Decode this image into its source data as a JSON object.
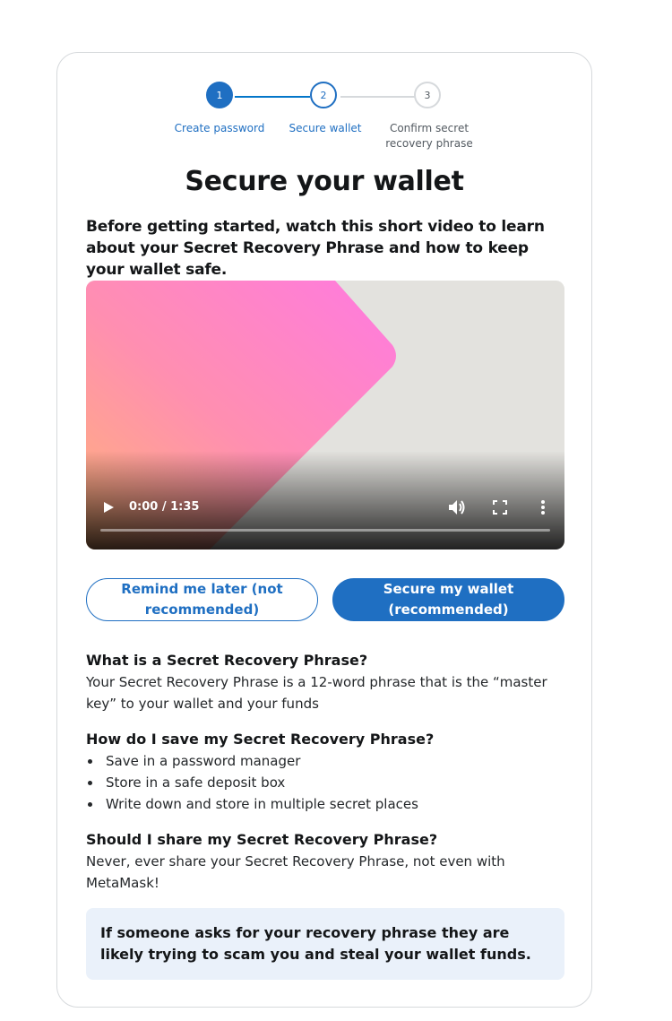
{
  "stepper": {
    "steps": [
      {
        "number": "1",
        "label": "Create password"
      },
      {
        "number": "2",
        "label": "Secure wallet"
      },
      {
        "number": "3",
        "label": "Confirm secret recovery phrase"
      }
    ],
    "current_step": 2
  },
  "title": "Secure your wallet",
  "intro": "Before getting started, watch this short video to learn about your Secret Recovery Phrase and how to keep your wallet safe.",
  "video": {
    "time": "0:00 / 1:35",
    "progress": 0,
    "controls": [
      "play-icon",
      "volume-icon",
      "fullscreen-icon",
      "more-options-icon"
    ]
  },
  "buttons": {
    "remind_later": "Remind me later (not recommended)",
    "secure_wallet": "Secure my wallet (recommended)"
  },
  "info": {
    "q1": "What is a Secret Recovery Phrase?",
    "a1": "Your Secret Recovery Phrase is a 12-word phrase that is the “master key” to your wallet and your funds",
    "q2": "How do I save my Secret Recovery Phrase?",
    "tips": [
      "Save in a password manager",
      "Store in a safe deposit box",
      "Write down and store in multiple secret places"
    ],
    "q3": "Should I share my Secret Recovery Phrase?",
    "a3": "Never, ever share your Secret Recovery Phrase, not even with MetaMask!"
  },
  "warning": "If someone asks for your recovery phrase they are likely trying to scam you and steal your wallet funds.",
  "colors": {
    "primary": "#1f6fc2",
    "warning_bg": "#eaf1fa",
    "border": "#d6d9dc"
  }
}
